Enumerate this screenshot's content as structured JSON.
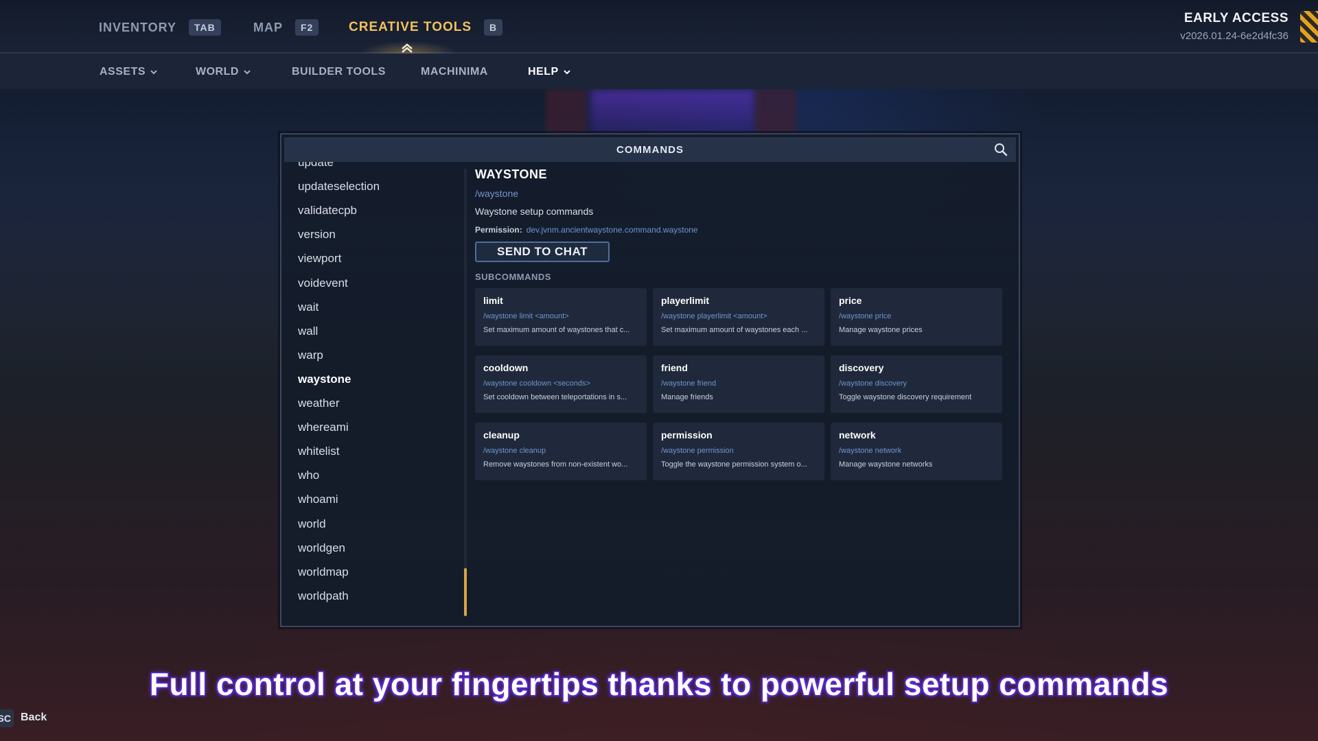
{
  "topbar": {
    "tabs": [
      {
        "label": "INVENTORY",
        "key": "TAB"
      },
      {
        "label": "MAP",
        "key": "F2"
      },
      {
        "label": "CREATIVE TOOLS",
        "key": "B"
      }
    ],
    "early_access": {
      "title": "EARLY ACCESS",
      "version": "v2026.01.24-6e2d4fc36"
    }
  },
  "subnav": {
    "items": [
      {
        "label": "ASSETS"
      },
      {
        "label": "WORLD"
      },
      {
        "label": "BUILDER TOOLS"
      },
      {
        "label": "MACHINIMA"
      },
      {
        "label": "HELP"
      }
    ]
  },
  "commands_panel": {
    "title": "COMMANDS",
    "list": [
      "update",
      "updateselection",
      "validatecpb",
      "version",
      "viewport",
      "voidevent",
      "wait",
      "wall",
      "warp",
      "waystone",
      "weather",
      "whereami",
      "whitelist",
      "who",
      "whoami",
      "world",
      "worldgen",
      "worldmap",
      "worldpath"
    ],
    "selected": "waystone",
    "detail": {
      "title": "WAYSTONE",
      "usage": "/waystone",
      "description": "Waystone setup commands",
      "permission_label": "Permission:",
      "permission_value": "dev.jvnm.ancientwaystone.command.waystone",
      "send_label": "SEND TO CHAT",
      "subcommands_heading": "SUBCOMMANDS",
      "subcommands": [
        {
          "name": "limit",
          "usage": "/waystone limit <amount>",
          "desc": "Set maximum amount of waystones that c..."
        },
        {
          "name": "playerlimit",
          "usage": "/waystone playerlimit <amount>",
          "desc": "Set maximum amount of waystones each ..."
        },
        {
          "name": "price",
          "usage": "/waystone price",
          "desc": "Manage waystone prices"
        },
        {
          "name": "cooldown",
          "usage": "/waystone cooldown <seconds>",
          "desc": "Set cooldown between teleportations in s..."
        },
        {
          "name": "friend",
          "usage": "/waystone friend",
          "desc": "Manage friends"
        },
        {
          "name": "discovery",
          "usage": "/waystone discovery",
          "desc": "Toggle waystone discovery requirement"
        },
        {
          "name": "cleanup",
          "usage": "/waystone cleanup",
          "desc": "Remove waystones from non-existent wo..."
        },
        {
          "name": "permission",
          "usage": "/waystone permission",
          "desc": "Toggle the waystone permission system o..."
        },
        {
          "name": "network",
          "usage": "/waystone network",
          "desc": "Manage waystone networks"
        }
      ]
    }
  },
  "caption": "Full control at your fingertips thanks to powerful setup commands",
  "footer": {
    "back_key": "SC",
    "back_label": "Back"
  },
  "colors": {
    "accent": "#f2c25f",
    "link": "#6f95d0",
    "scroll_thumb": "#d7a449",
    "caption_glow": "#6a36e0"
  }
}
